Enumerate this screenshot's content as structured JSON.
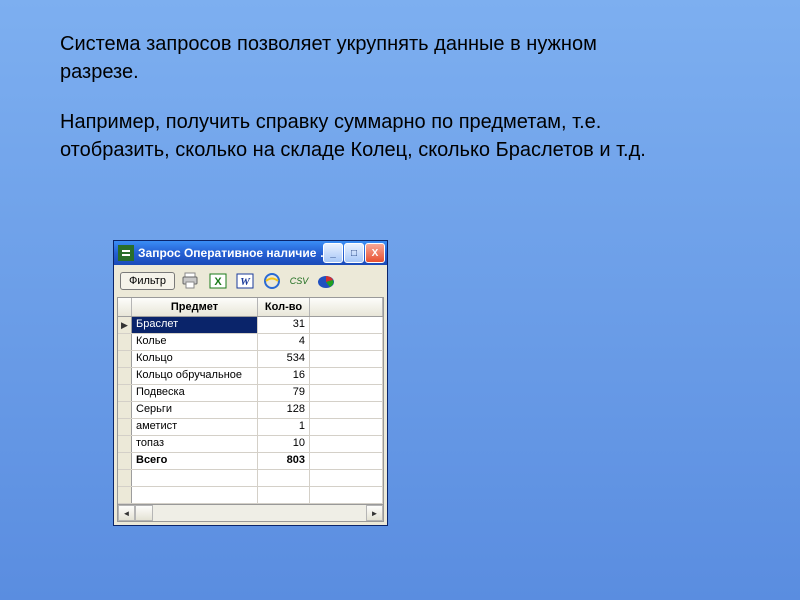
{
  "slide": {
    "p1": "Система запросов позволяет укрупнять данные в нужном разрезе.",
    "p2": "Например, получить справку суммарно по предметам, т.е. отобразить, сколько на складе Колец, сколько Браслетов и т.д."
  },
  "window": {
    "title": "Запрос Оперативное наличие …",
    "buttons": {
      "min": "_",
      "max": "□",
      "close": "X"
    }
  },
  "toolbar": {
    "filter_label": "Фильтр"
  },
  "grid": {
    "headers": {
      "item": "Предмет",
      "qty": "Кол-во"
    },
    "rows": [
      {
        "item": "Браслет",
        "qty": 31,
        "selected": true,
        "marker": "▶"
      },
      {
        "item": "Колье",
        "qty": 4
      },
      {
        "item": "Кольцо",
        "qty": 534
      },
      {
        "item": "Кольцо обручальное",
        "qty": 16
      },
      {
        "item": "Подвеска",
        "qty": 79
      },
      {
        "item": "Серьги",
        "qty": 128
      },
      {
        "item": "аметист",
        "qty": 1
      },
      {
        "item": "топаз",
        "qty": 10
      }
    ],
    "total": {
      "label": "Всего",
      "qty": 803
    }
  }
}
